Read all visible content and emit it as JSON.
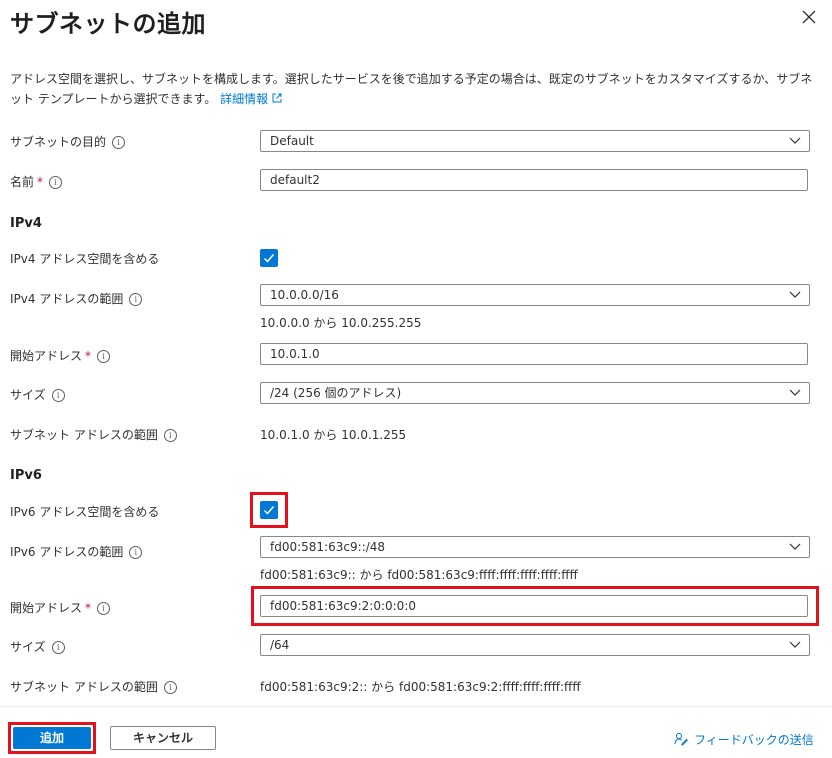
{
  "header": {
    "title": "サブネットの追加"
  },
  "description": {
    "text": "アドレス空間を選択し、サブネットを構成します。選択したサービスを後で追加する予定の場合は、既定のサブネットをカスタマイズするか、サブネット テンプレートから選択できます。 ",
    "link": "詳細情報"
  },
  "form": {
    "purpose": {
      "label": "サブネットの目的",
      "value": "Default"
    },
    "name": {
      "label": "名前",
      "required_mark": "*",
      "value": "default2"
    },
    "ipv4": {
      "section": "IPv4",
      "include_label": "IPv4 アドレス空間を含める",
      "include_checked": true,
      "range_label": "IPv4 アドレスの範囲",
      "range_value": "10.0.0.0/16",
      "range_hint": "10.0.0.0 から 10.0.255.255",
      "start_label": "開始アドレス",
      "start_value": "10.0.1.0",
      "size_label": "サイズ",
      "size_value": "/24 (256 個のアドレス)",
      "subnet_range_label": "サブネット アドレスの範囲",
      "subnet_range_value": "10.0.1.0 から 10.0.1.255"
    },
    "ipv6": {
      "section": "IPv6",
      "include_label": "IPv6 アドレス空間を含める",
      "include_checked": true,
      "range_label": "IPv6 アドレスの範囲",
      "range_value": "fd00:581:63c9::/48",
      "range_hint": "fd00:581:63c9:: から fd00:581:63c9:ffff:ffff:ffff:ffff:ffff",
      "start_label": "開始アドレス",
      "start_value": "fd00:581:63c9:2:0:0:0:0",
      "size_label": "サイズ",
      "size_value": "/64",
      "subnet_range_label": "サブネット アドレスの範囲",
      "subnet_range_value": "fd00:581:63c9:2:: から fd00:581:63c9:2:ffff:ffff:ffff:ffff"
    }
  },
  "footer": {
    "add_label": "追加",
    "cancel_label": "キャンセル",
    "feedback_label": "フィードバックの送信"
  },
  "colors": {
    "accent": "#0078d4",
    "highlight": "#e3111c",
    "required": "#a4262c"
  }
}
